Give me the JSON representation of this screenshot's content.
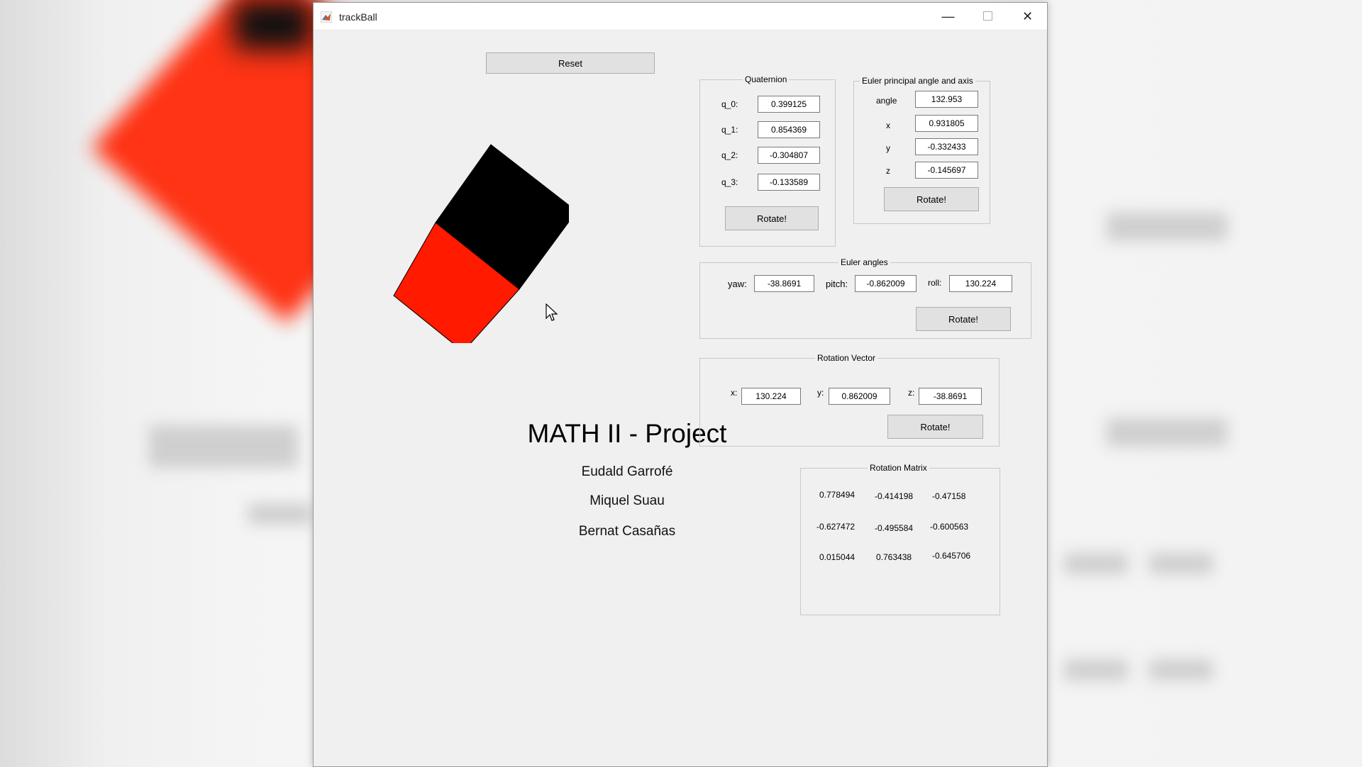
{
  "window": {
    "title": "trackBall"
  },
  "controls": {
    "reset_label": "Reset",
    "minimize": "—",
    "maximize": "☐",
    "close": "✕"
  },
  "quaternion": {
    "title": "Quaternion",
    "q0_label": "q_0:",
    "q0": "0.399125",
    "q1_label": "q_1:",
    "q1": "0.854369",
    "q2_label": "q_2:",
    "q2": "-0.304807",
    "q3_label": "q_3:",
    "q3": "-0.133589",
    "rotate": "Rotate!"
  },
  "euler_axis": {
    "title": "Euler principal angle and axis",
    "angle_label": "angle",
    "angle": "132.953",
    "x_label": "x",
    "x": "0.931805",
    "y_label": "y",
    "y": "-0.332433",
    "z_label": "z",
    "z": "-0.145697",
    "rotate": "Rotate!"
  },
  "euler_angles": {
    "title": "Euler angles",
    "yaw_label": "yaw:",
    "yaw": "-38.8691",
    "pitch_label": "pitch:",
    "pitch": "-0.862009",
    "roll_label": "roll:",
    "roll": "130.224",
    "rotate": "Rotate!"
  },
  "rotation_vector": {
    "title": "Rotation Vector",
    "x_label": "x:",
    "x": "130.224",
    "y_label": "y:",
    "y": "0.862009",
    "z_label": "z:",
    "z": "-38.8691",
    "rotate": "Rotate!"
  },
  "rotation_matrix": {
    "title": "Rotation Matrix",
    "rows": [
      [
        "0.778494",
        "-0.414198",
        "-0.47158"
      ],
      [
        "-0.627472",
        "-0.495584",
        "-0.600563"
      ],
      [
        "0.015044",
        "0.763438",
        "-0.645706"
      ]
    ]
  },
  "project": {
    "title": "MATH II - Project",
    "authors": [
      "Eudald Garrofé",
      "Miquel Suau",
      "Bernat Casañas"
    ]
  },
  "cube": {
    "face_colors": [
      "#000000",
      "#ff1a00"
    ]
  }
}
